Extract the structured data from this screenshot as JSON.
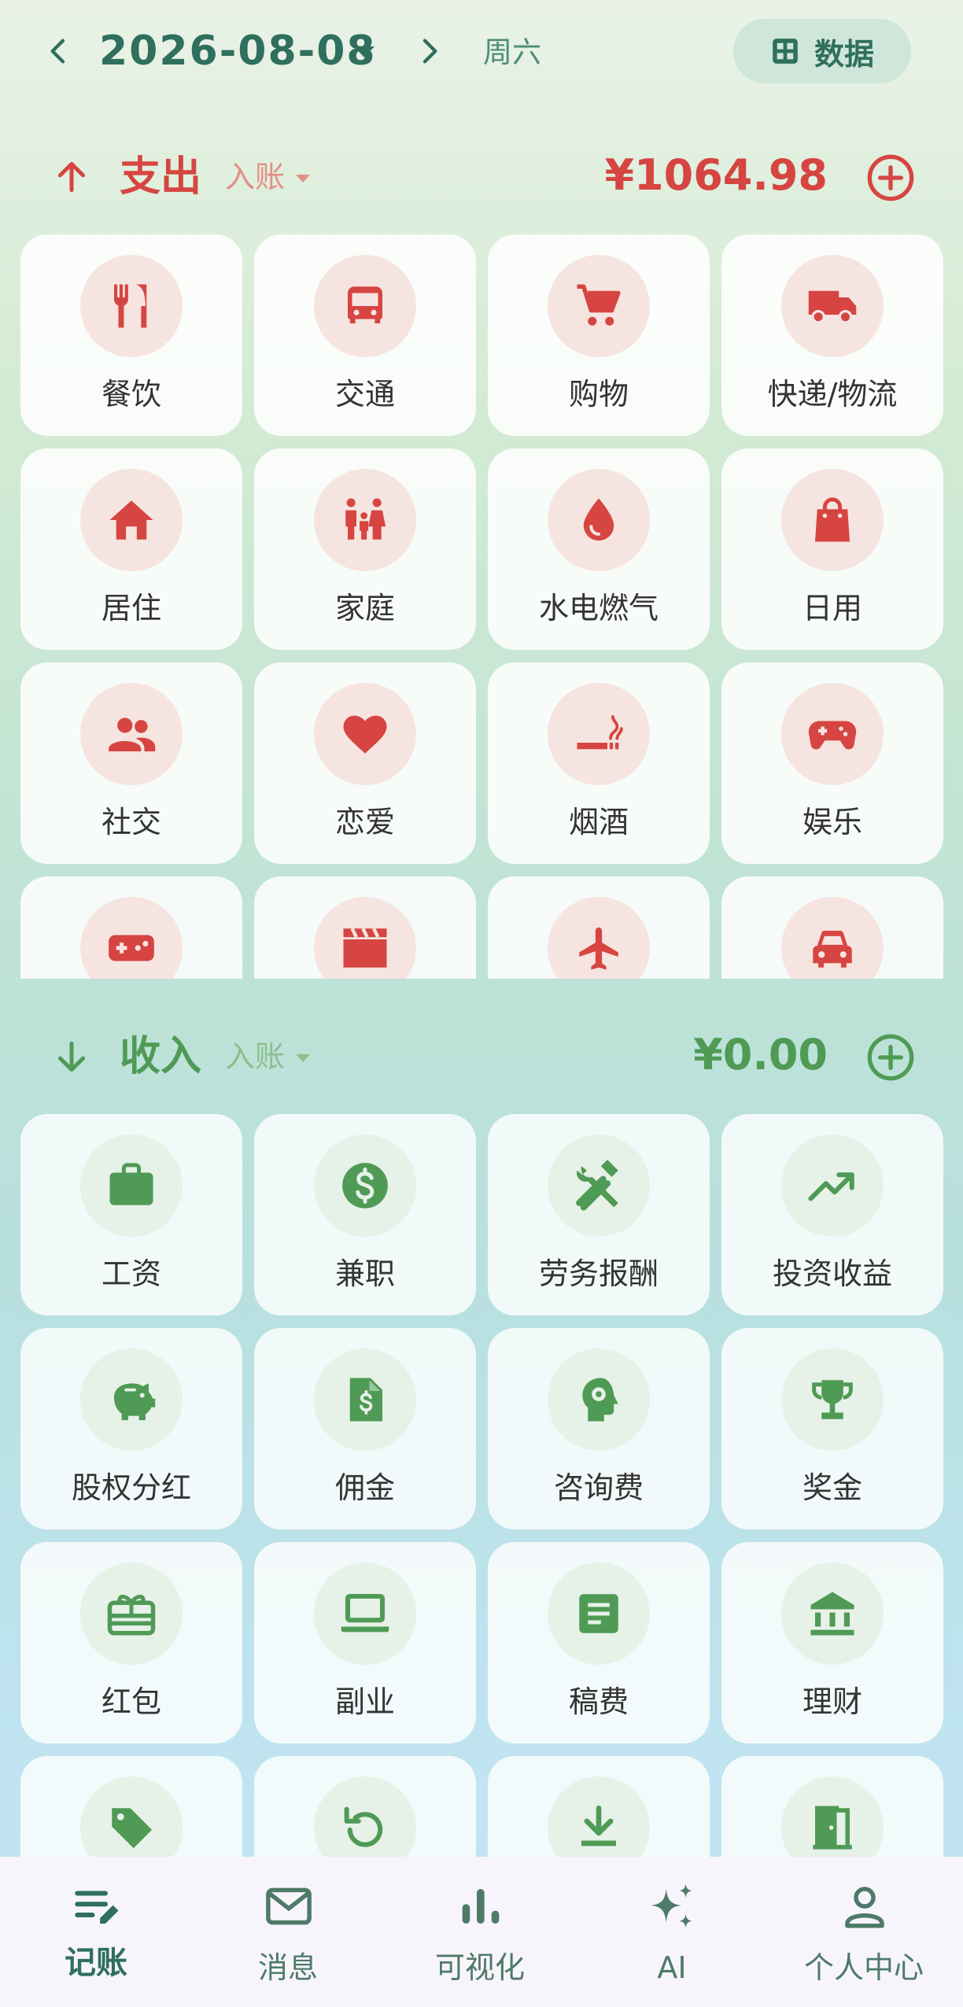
{
  "header": {
    "date": "2026-08-08",
    "weekday": "周六",
    "data_button_label": "数据"
  },
  "colors": {
    "expense": "#d64541",
    "income": "#4f9a55",
    "primary": "#2f6f5d"
  },
  "expense": {
    "title": "支出",
    "mode": "入账",
    "amount": "¥1064.98",
    "categories": [
      {
        "label": "餐饮",
        "icon": "restaurant-icon"
      },
      {
        "label": "交通",
        "icon": "bus-icon"
      },
      {
        "label": "购物",
        "icon": "shopping-cart-icon"
      },
      {
        "label": "快递/物流",
        "icon": "truck-icon"
      },
      {
        "label": "居住",
        "icon": "home-icon"
      },
      {
        "label": "家庭",
        "icon": "family-icon"
      },
      {
        "label": "水电燃气",
        "icon": "water-drop-icon"
      },
      {
        "label": "日用",
        "icon": "shopping-bag-icon"
      },
      {
        "label": "社交",
        "icon": "people-icon"
      },
      {
        "label": "恋爱",
        "icon": "heart-icon"
      },
      {
        "label": "烟酒",
        "icon": "smoking-icon"
      },
      {
        "label": "娱乐",
        "icon": "gamepad-icon"
      },
      {
        "label": "",
        "icon": "game-controller-icon"
      },
      {
        "label": "",
        "icon": "movie-clapper-icon"
      },
      {
        "label": "",
        "icon": "airplane-icon"
      },
      {
        "label": "",
        "icon": "car-icon"
      }
    ]
  },
  "income": {
    "title": "收入",
    "mode": "入账",
    "amount": "¥0.00",
    "categories": [
      {
        "label": "工资",
        "icon": "briefcase-icon"
      },
      {
        "label": "兼职",
        "icon": "dollar-coin-icon"
      },
      {
        "label": "劳务报酬",
        "icon": "tools-icon"
      },
      {
        "label": "投资收益",
        "icon": "trending-up-icon"
      },
      {
        "label": "股权分红",
        "icon": "piggy-bank-icon"
      },
      {
        "label": "佣金",
        "icon": "invoice-dollar-icon"
      },
      {
        "label": "咨询费",
        "icon": "consult-head-icon"
      },
      {
        "label": "奖金",
        "icon": "trophy-icon"
      },
      {
        "label": "红包",
        "icon": "gift-card-icon"
      },
      {
        "label": "副业",
        "icon": "laptop-icon"
      },
      {
        "label": "稿费",
        "icon": "article-icon"
      },
      {
        "label": "理财",
        "icon": "bank-icon"
      },
      {
        "label": "",
        "icon": "tag-icon"
      },
      {
        "label": "",
        "icon": "refund-icon"
      },
      {
        "label": "",
        "icon": "download-icon"
      },
      {
        "label": "",
        "icon": "door-exit-icon"
      }
    ]
  },
  "nav": [
    {
      "label": "记账",
      "icon": "edit-notes-icon",
      "active": true
    },
    {
      "label": "消息",
      "icon": "mail-icon",
      "active": false
    },
    {
      "label": "可视化",
      "icon": "bar-chart-icon",
      "active": false
    },
    {
      "label": "AI",
      "icon": "sparkle-icon",
      "active": false
    },
    {
      "label": "个人中心",
      "icon": "person-icon",
      "active": false
    }
  ]
}
